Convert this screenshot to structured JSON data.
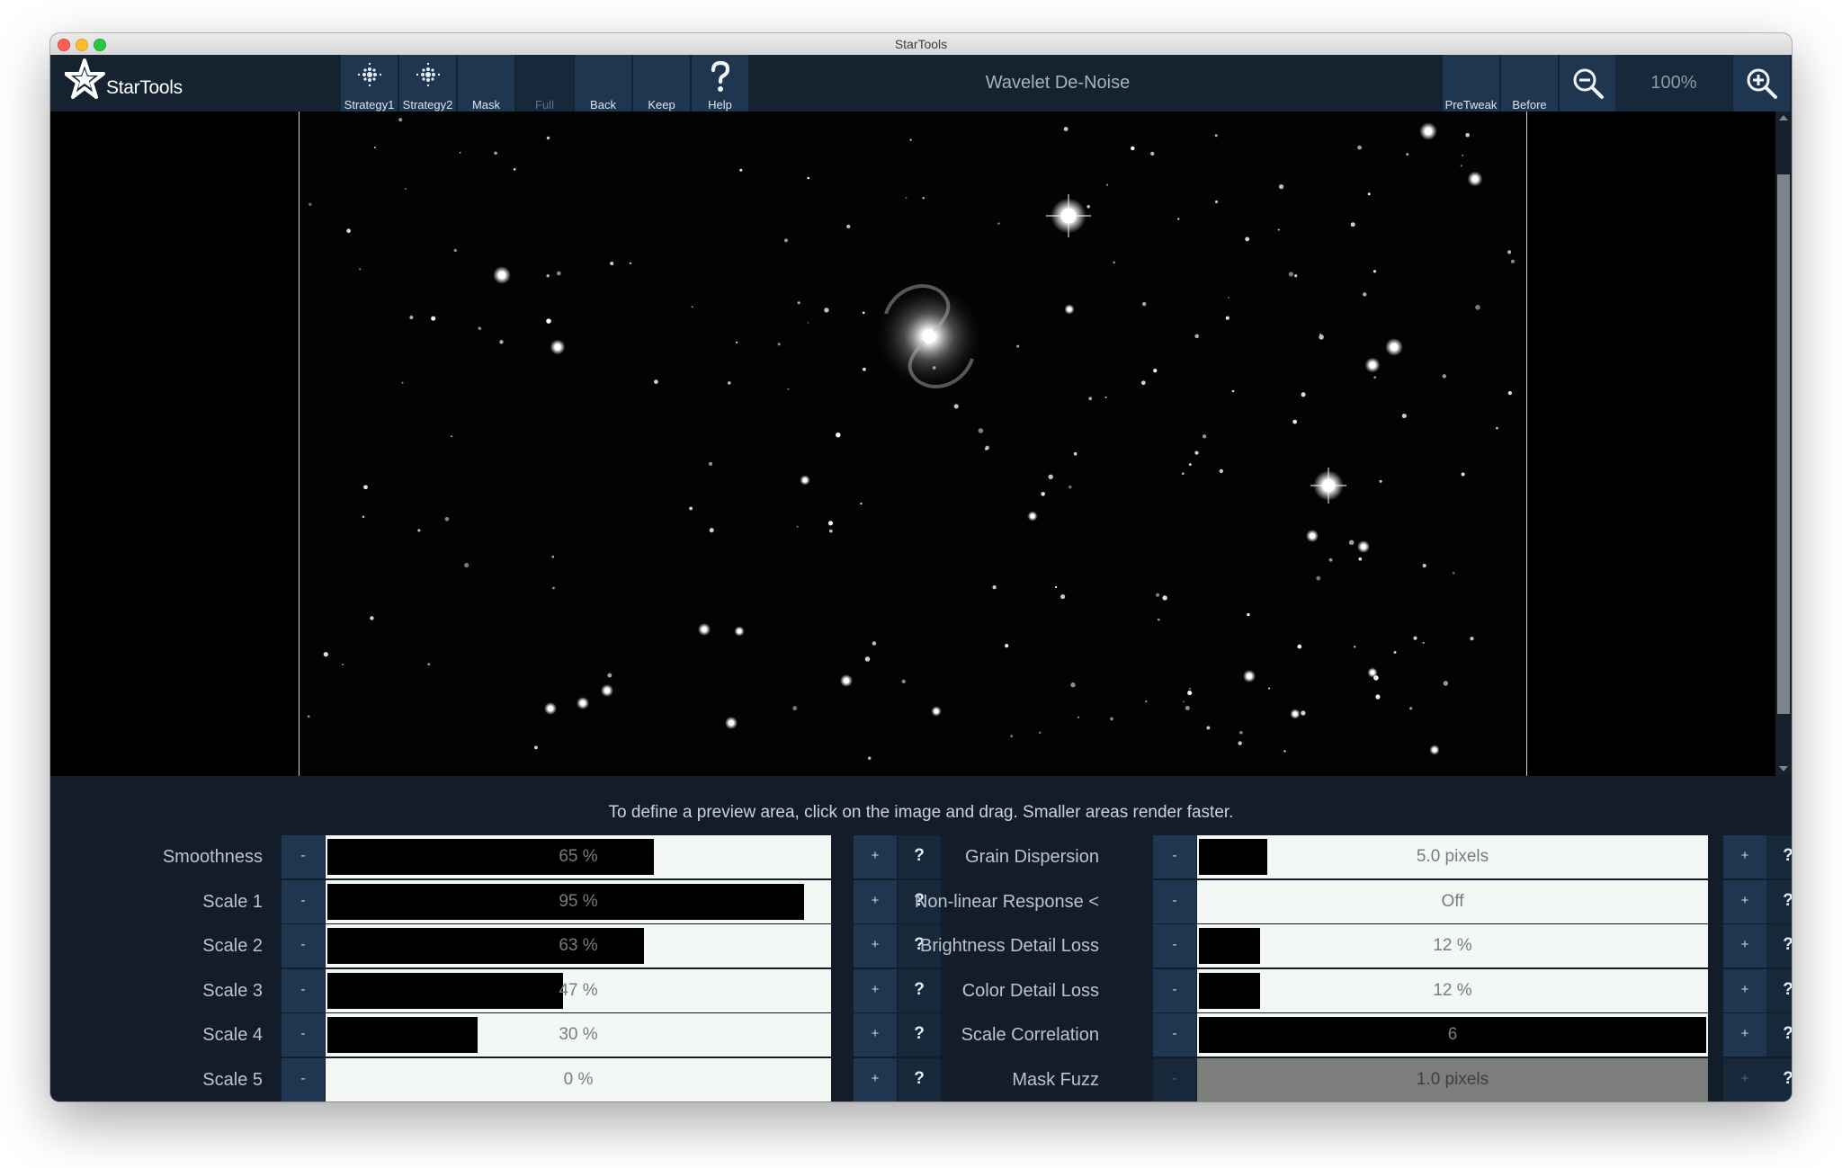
{
  "window": {
    "title": "StarTools"
  },
  "app": {
    "logo_text": "StarTools"
  },
  "toolbar": {
    "buttons": [
      {
        "id": "strategy1",
        "label": "Strategy1",
        "icon": "dots-icon"
      },
      {
        "id": "strategy2",
        "label": "Strategy2",
        "icon": "dots-icon"
      },
      {
        "id": "mask",
        "label": "Mask"
      },
      {
        "id": "full",
        "label": "Full",
        "disabled": true
      },
      {
        "id": "back",
        "label": "Back"
      },
      {
        "id": "keep",
        "label": "Keep"
      },
      {
        "id": "help",
        "label": "Help",
        "icon": "question-icon"
      }
    ],
    "tool_title": "Wavelet De-Noise",
    "right_buttons": [
      {
        "id": "pretweak",
        "label": "PreTweak"
      },
      {
        "id": "before",
        "label": "Before"
      }
    ],
    "zoom": "100%",
    "zoom_out_icon": "zoom-out-icon",
    "zoom_in_icon": "zoom-in-icon"
  },
  "hint": "To define a preview area, click on the image and drag. Smaller areas render faster.",
  "params_left": [
    {
      "label": "Smoothness",
      "value": "65 %",
      "level": 0.65
    },
    {
      "label": "Scale 1",
      "value": "95 %",
      "level": 0.95
    },
    {
      "label": "Scale 2",
      "value": "63 %",
      "level": 0.63
    },
    {
      "label": "Scale 3",
      "value": "47 %",
      "level": 0.47
    },
    {
      "label": "Scale 4",
      "value": "30 %",
      "level": 0.3
    },
    {
      "label": "Scale 5",
      "value": "0 %",
      "level": 0.0
    }
  ],
  "params_right": [
    {
      "label": "Grain Dispersion",
      "value": "5.0 pixels",
      "level": 0.135
    },
    {
      "label": "Non-linear Response <",
      "value": "Off",
      "level": 0.0
    },
    {
      "label": "Brightness Detail Loss",
      "value": "12 %",
      "level": 0.12
    },
    {
      "label": "Color Detail Loss",
      "value": "12 %",
      "level": 0.12
    },
    {
      "label": "Scale Correlation",
      "value": "6",
      "level": 1.0
    },
    {
      "label": "Mask Fuzz",
      "value": "1.0 pixels",
      "level": 0.0,
      "disabled": true
    }
  ],
  "button_labels": {
    "minus": "-",
    "plus": "+",
    "help": "?"
  },
  "colors": {
    "accent": "#1f3650",
    "toolbar": "#152230",
    "panel": "#121d29"
  }
}
